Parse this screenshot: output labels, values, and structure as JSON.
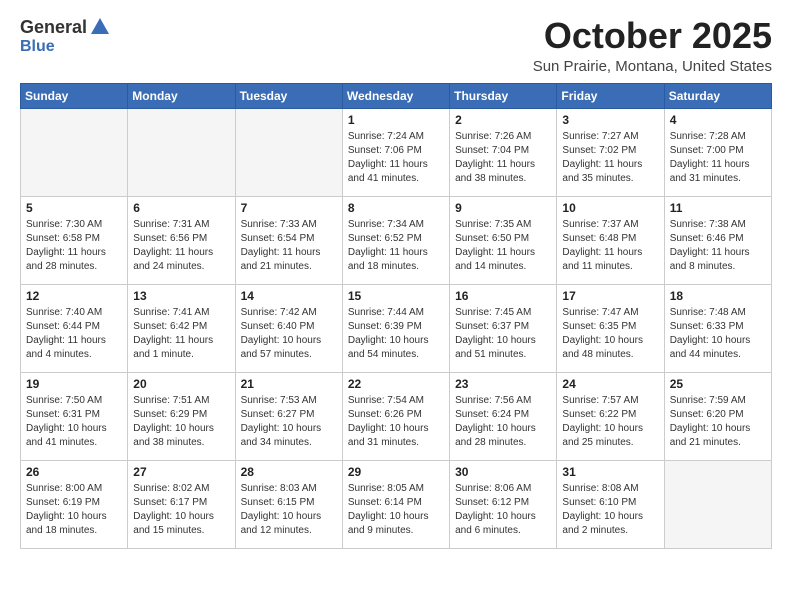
{
  "header": {
    "logo_general": "General",
    "logo_blue": "Blue",
    "month_title": "October 2025",
    "location": "Sun Prairie, Montana, United States"
  },
  "weekdays": [
    "Sunday",
    "Monday",
    "Tuesday",
    "Wednesday",
    "Thursday",
    "Friday",
    "Saturday"
  ],
  "weeks": [
    [
      {
        "day": "",
        "sunrise": "",
        "sunset": "",
        "daylight": "",
        "empty": true
      },
      {
        "day": "",
        "sunrise": "",
        "sunset": "",
        "daylight": "",
        "empty": true
      },
      {
        "day": "",
        "sunrise": "",
        "sunset": "",
        "daylight": "",
        "empty": true
      },
      {
        "day": "1",
        "sunrise": "Sunrise: 7:24 AM",
        "sunset": "Sunset: 7:06 PM",
        "daylight": "Daylight: 11 hours and 41 minutes."
      },
      {
        "day": "2",
        "sunrise": "Sunrise: 7:26 AM",
        "sunset": "Sunset: 7:04 PM",
        "daylight": "Daylight: 11 hours and 38 minutes."
      },
      {
        "day": "3",
        "sunrise": "Sunrise: 7:27 AM",
        "sunset": "Sunset: 7:02 PM",
        "daylight": "Daylight: 11 hours and 35 minutes."
      },
      {
        "day": "4",
        "sunrise": "Sunrise: 7:28 AM",
        "sunset": "Sunset: 7:00 PM",
        "daylight": "Daylight: 11 hours and 31 minutes."
      }
    ],
    [
      {
        "day": "5",
        "sunrise": "Sunrise: 7:30 AM",
        "sunset": "Sunset: 6:58 PM",
        "daylight": "Daylight: 11 hours and 28 minutes."
      },
      {
        "day": "6",
        "sunrise": "Sunrise: 7:31 AM",
        "sunset": "Sunset: 6:56 PM",
        "daylight": "Daylight: 11 hours and 24 minutes."
      },
      {
        "day": "7",
        "sunrise": "Sunrise: 7:33 AM",
        "sunset": "Sunset: 6:54 PM",
        "daylight": "Daylight: 11 hours and 21 minutes."
      },
      {
        "day": "8",
        "sunrise": "Sunrise: 7:34 AM",
        "sunset": "Sunset: 6:52 PM",
        "daylight": "Daylight: 11 hours and 18 minutes."
      },
      {
        "day": "9",
        "sunrise": "Sunrise: 7:35 AM",
        "sunset": "Sunset: 6:50 PM",
        "daylight": "Daylight: 11 hours and 14 minutes."
      },
      {
        "day": "10",
        "sunrise": "Sunrise: 7:37 AM",
        "sunset": "Sunset: 6:48 PM",
        "daylight": "Daylight: 11 hours and 11 minutes."
      },
      {
        "day": "11",
        "sunrise": "Sunrise: 7:38 AM",
        "sunset": "Sunset: 6:46 PM",
        "daylight": "Daylight: 11 hours and 8 minutes."
      }
    ],
    [
      {
        "day": "12",
        "sunrise": "Sunrise: 7:40 AM",
        "sunset": "Sunset: 6:44 PM",
        "daylight": "Daylight: 11 hours and 4 minutes."
      },
      {
        "day": "13",
        "sunrise": "Sunrise: 7:41 AM",
        "sunset": "Sunset: 6:42 PM",
        "daylight": "Daylight: 11 hours and 1 minute."
      },
      {
        "day": "14",
        "sunrise": "Sunrise: 7:42 AM",
        "sunset": "Sunset: 6:40 PM",
        "daylight": "Daylight: 10 hours and 57 minutes."
      },
      {
        "day": "15",
        "sunrise": "Sunrise: 7:44 AM",
        "sunset": "Sunset: 6:39 PM",
        "daylight": "Daylight: 10 hours and 54 minutes."
      },
      {
        "day": "16",
        "sunrise": "Sunrise: 7:45 AM",
        "sunset": "Sunset: 6:37 PM",
        "daylight": "Daylight: 10 hours and 51 minutes."
      },
      {
        "day": "17",
        "sunrise": "Sunrise: 7:47 AM",
        "sunset": "Sunset: 6:35 PM",
        "daylight": "Daylight: 10 hours and 48 minutes."
      },
      {
        "day": "18",
        "sunrise": "Sunrise: 7:48 AM",
        "sunset": "Sunset: 6:33 PM",
        "daylight": "Daylight: 10 hours and 44 minutes."
      }
    ],
    [
      {
        "day": "19",
        "sunrise": "Sunrise: 7:50 AM",
        "sunset": "Sunset: 6:31 PM",
        "daylight": "Daylight: 10 hours and 41 minutes."
      },
      {
        "day": "20",
        "sunrise": "Sunrise: 7:51 AM",
        "sunset": "Sunset: 6:29 PM",
        "daylight": "Daylight: 10 hours and 38 minutes."
      },
      {
        "day": "21",
        "sunrise": "Sunrise: 7:53 AM",
        "sunset": "Sunset: 6:27 PM",
        "daylight": "Daylight: 10 hours and 34 minutes."
      },
      {
        "day": "22",
        "sunrise": "Sunrise: 7:54 AM",
        "sunset": "Sunset: 6:26 PM",
        "daylight": "Daylight: 10 hours and 31 minutes."
      },
      {
        "day": "23",
        "sunrise": "Sunrise: 7:56 AM",
        "sunset": "Sunset: 6:24 PM",
        "daylight": "Daylight: 10 hours and 28 minutes."
      },
      {
        "day": "24",
        "sunrise": "Sunrise: 7:57 AM",
        "sunset": "Sunset: 6:22 PM",
        "daylight": "Daylight: 10 hours and 25 minutes."
      },
      {
        "day": "25",
        "sunrise": "Sunrise: 7:59 AM",
        "sunset": "Sunset: 6:20 PM",
        "daylight": "Daylight: 10 hours and 21 minutes."
      }
    ],
    [
      {
        "day": "26",
        "sunrise": "Sunrise: 8:00 AM",
        "sunset": "Sunset: 6:19 PM",
        "daylight": "Daylight: 10 hours and 18 minutes."
      },
      {
        "day": "27",
        "sunrise": "Sunrise: 8:02 AM",
        "sunset": "Sunset: 6:17 PM",
        "daylight": "Daylight: 10 hours and 15 minutes."
      },
      {
        "day": "28",
        "sunrise": "Sunrise: 8:03 AM",
        "sunset": "Sunset: 6:15 PM",
        "daylight": "Daylight: 10 hours and 12 minutes."
      },
      {
        "day": "29",
        "sunrise": "Sunrise: 8:05 AM",
        "sunset": "Sunset: 6:14 PM",
        "daylight": "Daylight: 10 hours and 9 minutes."
      },
      {
        "day": "30",
        "sunrise": "Sunrise: 8:06 AM",
        "sunset": "Sunset: 6:12 PM",
        "daylight": "Daylight: 10 hours and 6 minutes."
      },
      {
        "day": "31",
        "sunrise": "Sunrise: 8:08 AM",
        "sunset": "Sunset: 6:10 PM",
        "daylight": "Daylight: 10 hours and 2 minutes."
      },
      {
        "day": "",
        "sunrise": "",
        "sunset": "",
        "daylight": "",
        "empty": true
      }
    ]
  ]
}
